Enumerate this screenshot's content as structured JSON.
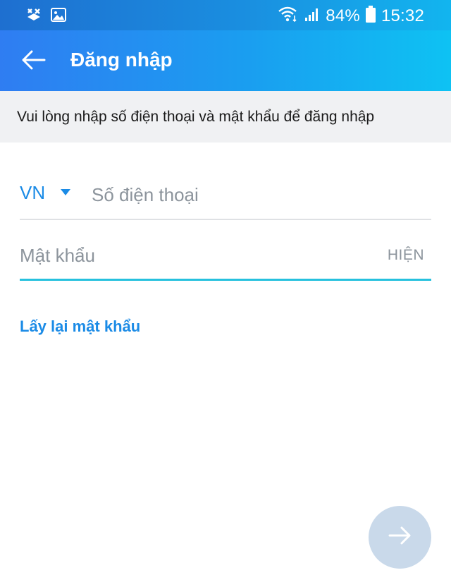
{
  "status_bar": {
    "battery_percent": "84%",
    "time": "15:32",
    "icons": [
      "no-signal-icon",
      "image-notification-icon",
      "wifi-icon",
      "cellular-signal-icon",
      "battery-icon"
    ]
  },
  "header": {
    "title": "Đăng nhập",
    "back_icon": "arrow-left-icon"
  },
  "hint": {
    "text": "Vui lòng nhập số điện thoại và mật khẩu để đăng nhập"
  },
  "form": {
    "country_code": "VN",
    "phone_placeholder": "Số điện thoại",
    "phone_value": "",
    "password_placeholder": "Mật khẩu",
    "password_value": "",
    "show_label": "HIỆN"
  },
  "forgot_password": {
    "label": "Lấy lại mật khẩu"
  },
  "next_button": {
    "icon": "arrow-right-icon",
    "enabled": false
  },
  "colors": {
    "accent": "#1b8be6",
    "focus_underline": "#27c1de",
    "header_gradient_start": "#2f7df2",
    "header_gradient_end": "#0ec2f3",
    "fab_disabled": "#c9d9ea"
  }
}
